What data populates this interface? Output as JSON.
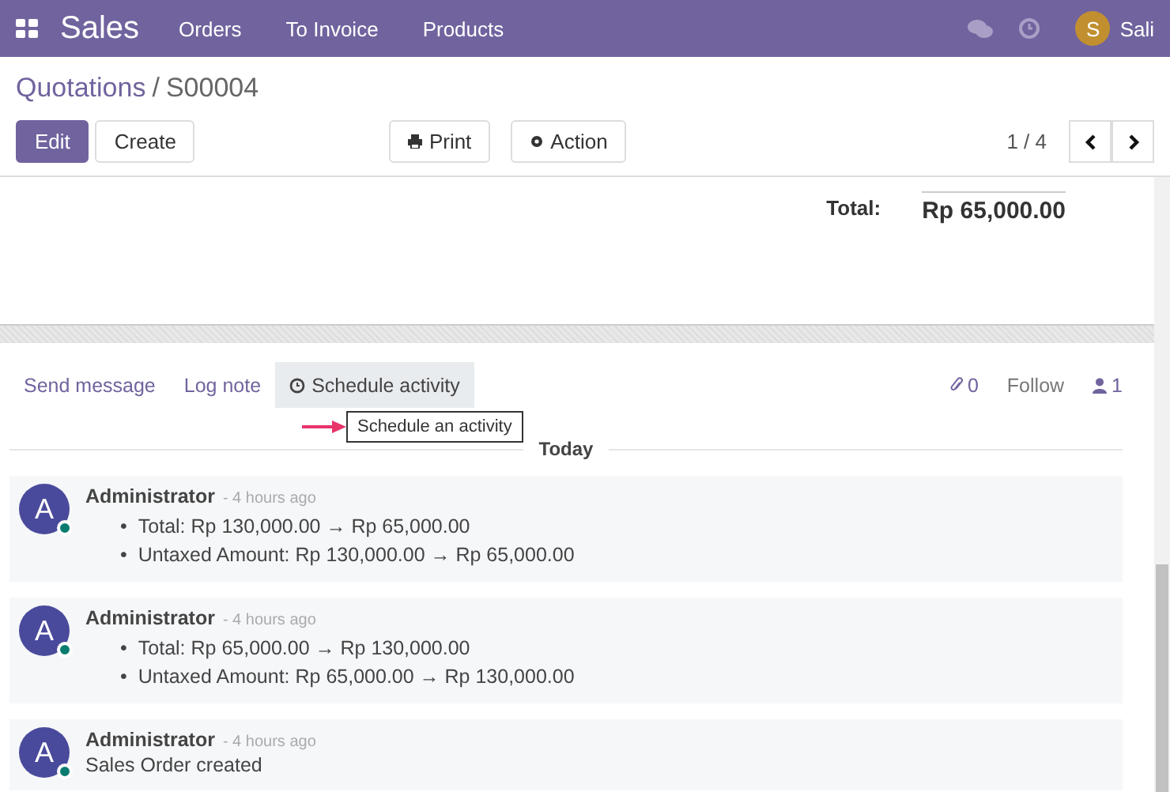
{
  "navbar": {
    "app": "Sales",
    "menu": [
      "Orders",
      "To Invoice",
      "Products"
    ],
    "user": {
      "initial": "S",
      "name": "Sali"
    }
  },
  "breadcrumb": {
    "parent": "Quotations",
    "separator": "/",
    "current": "S00004"
  },
  "buttons": {
    "primary": "Edit",
    "secondary": "Create",
    "print": "Print",
    "action": "Action"
  },
  "pager": "1 / 4",
  "form": {
    "total_label": "Total:",
    "total_value": "Rp 65,000.00"
  },
  "chatter": {
    "tabs": [
      {
        "label": "Send message",
        "selected": false
      },
      {
        "label": "Log note",
        "selected": false
      },
      {
        "label": "Schedule activity",
        "selected": true
      }
    ],
    "tooltip": "Schedule an activity",
    "bullet": "•",
    "attachments": "0",
    "follow": "Follow",
    "followers": "1",
    "date_separator": "Today",
    "messages": [
      {
        "author": "Administrator",
        "initial": "A",
        "time": "- 4 hours ago",
        "kind": "changes",
        "lines": [
          "Total: Rp 130,000.00 → Rp 65,000.00",
          "Untaxed Amount: Rp 130,000.00 → Rp 65,000.00"
        ]
      },
      {
        "author": "Administrator",
        "initial": "A",
        "time": "- 4 hours ago",
        "kind": "changes",
        "lines": [
          "Total: Rp 65,000.00 → Rp 130,000.00",
          "Untaxed Amount: Rp 65,000.00 → Rp 130,000.00"
        ]
      },
      {
        "author": "Administrator",
        "initial": "A",
        "time": "- 4 hours ago",
        "kind": "text",
        "lines": [
          "Sales Order created"
        ]
      }
    ]
  }
}
